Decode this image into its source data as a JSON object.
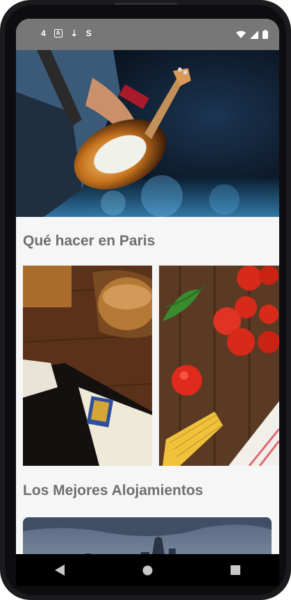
{
  "status_bar": {
    "left_icons": [
      "4",
      "A",
      "⇣",
      "S"
    ],
    "signal": "wifi-icon",
    "cell": "cell-signal-icon",
    "battery": "battery-icon"
  },
  "sections": {
    "things_to_do_title": "Qué hacer en Paris",
    "best_stays_title": "Los Mejores Alojamientos"
  },
  "colors": {
    "status_bar": "#777777",
    "background": "#f6f6f6",
    "section_title": "#6f6f6f",
    "nav_bar": "#000000"
  },
  "nav": {
    "back": "back-icon",
    "home": "home-icon",
    "recents": "recents-icon"
  }
}
